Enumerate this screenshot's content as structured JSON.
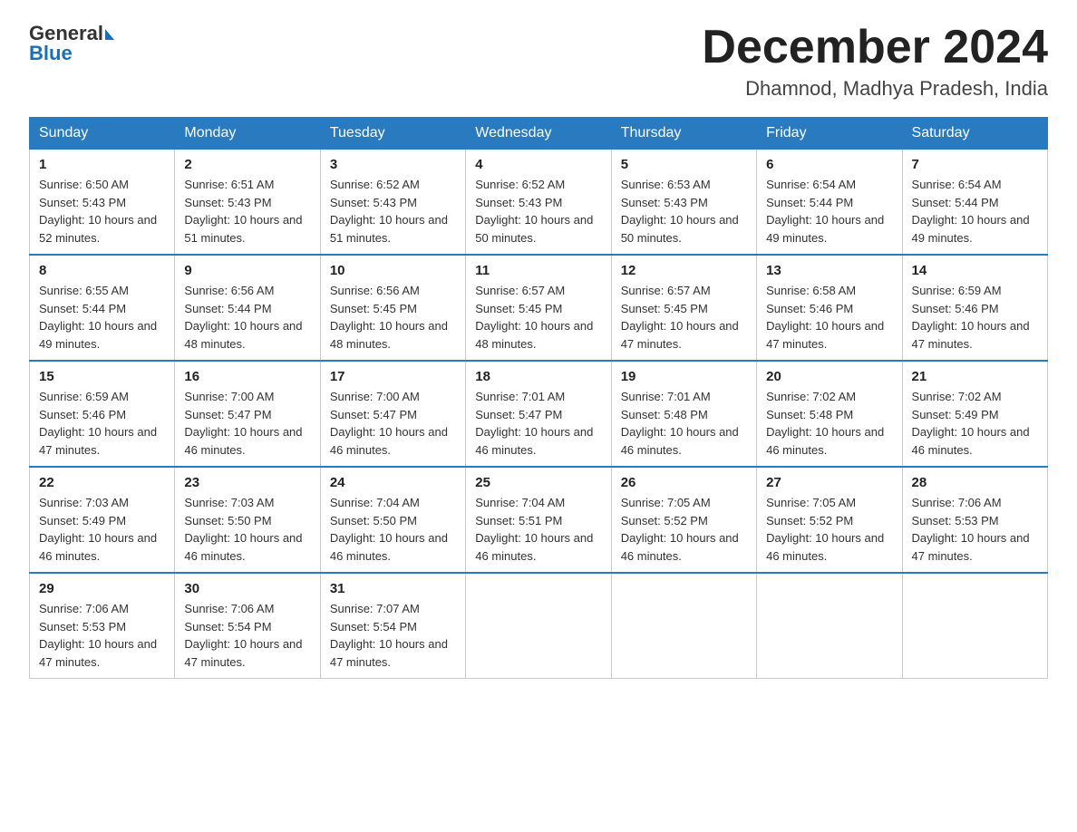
{
  "header": {
    "logo_general": "General",
    "logo_blue": "Blue",
    "month_year": "December 2024",
    "location": "Dhamnod, Madhya Pradesh, India"
  },
  "days_of_week": [
    "Sunday",
    "Monday",
    "Tuesday",
    "Wednesday",
    "Thursday",
    "Friday",
    "Saturday"
  ],
  "weeks": [
    [
      {
        "num": "1",
        "sunrise": "6:50 AM",
        "sunset": "5:43 PM",
        "daylight": "10 hours and 52 minutes."
      },
      {
        "num": "2",
        "sunrise": "6:51 AM",
        "sunset": "5:43 PM",
        "daylight": "10 hours and 51 minutes."
      },
      {
        "num": "3",
        "sunrise": "6:52 AM",
        "sunset": "5:43 PM",
        "daylight": "10 hours and 51 minutes."
      },
      {
        "num": "4",
        "sunrise": "6:52 AM",
        "sunset": "5:43 PM",
        "daylight": "10 hours and 50 minutes."
      },
      {
        "num": "5",
        "sunrise": "6:53 AM",
        "sunset": "5:43 PM",
        "daylight": "10 hours and 50 minutes."
      },
      {
        "num": "6",
        "sunrise": "6:54 AM",
        "sunset": "5:44 PM",
        "daylight": "10 hours and 49 minutes."
      },
      {
        "num": "7",
        "sunrise": "6:54 AM",
        "sunset": "5:44 PM",
        "daylight": "10 hours and 49 minutes."
      }
    ],
    [
      {
        "num": "8",
        "sunrise": "6:55 AM",
        "sunset": "5:44 PM",
        "daylight": "10 hours and 49 minutes."
      },
      {
        "num": "9",
        "sunrise": "6:56 AM",
        "sunset": "5:44 PM",
        "daylight": "10 hours and 48 minutes."
      },
      {
        "num": "10",
        "sunrise": "6:56 AM",
        "sunset": "5:45 PM",
        "daylight": "10 hours and 48 minutes."
      },
      {
        "num": "11",
        "sunrise": "6:57 AM",
        "sunset": "5:45 PM",
        "daylight": "10 hours and 48 minutes."
      },
      {
        "num": "12",
        "sunrise": "6:57 AM",
        "sunset": "5:45 PM",
        "daylight": "10 hours and 47 minutes."
      },
      {
        "num": "13",
        "sunrise": "6:58 AM",
        "sunset": "5:46 PM",
        "daylight": "10 hours and 47 minutes."
      },
      {
        "num": "14",
        "sunrise": "6:59 AM",
        "sunset": "5:46 PM",
        "daylight": "10 hours and 47 minutes."
      }
    ],
    [
      {
        "num": "15",
        "sunrise": "6:59 AM",
        "sunset": "5:46 PM",
        "daylight": "10 hours and 47 minutes."
      },
      {
        "num": "16",
        "sunrise": "7:00 AM",
        "sunset": "5:47 PM",
        "daylight": "10 hours and 46 minutes."
      },
      {
        "num": "17",
        "sunrise": "7:00 AM",
        "sunset": "5:47 PM",
        "daylight": "10 hours and 46 minutes."
      },
      {
        "num": "18",
        "sunrise": "7:01 AM",
        "sunset": "5:47 PM",
        "daylight": "10 hours and 46 minutes."
      },
      {
        "num": "19",
        "sunrise": "7:01 AM",
        "sunset": "5:48 PM",
        "daylight": "10 hours and 46 minutes."
      },
      {
        "num": "20",
        "sunrise": "7:02 AM",
        "sunset": "5:48 PM",
        "daylight": "10 hours and 46 minutes."
      },
      {
        "num": "21",
        "sunrise": "7:02 AM",
        "sunset": "5:49 PM",
        "daylight": "10 hours and 46 minutes."
      }
    ],
    [
      {
        "num": "22",
        "sunrise": "7:03 AM",
        "sunset": "5:49 PM",
        "daylight": "10 hours and 46 minutes."
      },
      {
        "num": "23",
        "sunrise": "7:03 AM",
        "sunset": "5:50 PM",
        "daylight": "10 hours and 46 minutes."
      },
      {
        "num": "24",
        "sunrise": "7:04 AM",
        "sunset": "5:50 PM",
        "daylight": "10 hours and 46 minutes."
      },
      {
        "num": "25",
        "sunrise": "7:04 AM",
        "sunset": "5:51 PM",
        "daylight": "10 hours and 46 minutes."
      },
      {
        "num": "26",
        "sunrise": "7:05 AM",
        "sunset": "5:52 PM",
        "daylight": "10 hours and 46 minutes."
      },
      {
        "num": "27",
        "sunrise": "7:05 AM",
        "sunset": "5:52 PM",
        "daylight": "10 hours and 46 minutes."
      },
      {
        "num": "28",
        "sunrise": "7:06 AM",
        "sunset": "5:53 PM",
        "daylight": "10 hours and 47 minutes."
      }
    ],
    [
      {
        "num": "29",
        "sunrise": "7:06 AM",
        "sunset": "5:53 PM",
        "daylight": "10 hours and 47 minutes."
      },
      {
        "num": "30",
        "sunrise": "7:06 AM",
        "sunset": "5:54 PM",
        "daylight": "10 hours and 47 minutes."
      },
      {
        "num": "31",
        "sunrise": "7:07 AM",
        "sunset": "5:54 PM",
        "daylight": "10 hours and 47 minutes."
      },
      null,
      null,
      null,
      null
    ]
  ]
}
